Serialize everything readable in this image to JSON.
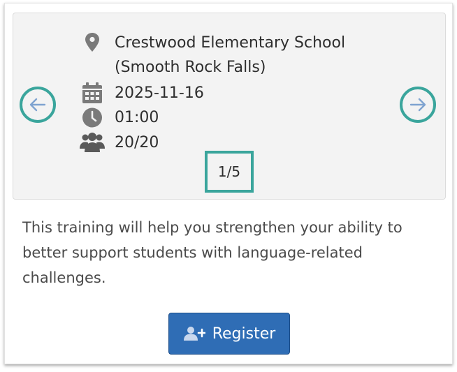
{
  "event": {
    "location_line1": "Crestwood Elementary School",
    "location_line2": "(Smooth Rock Falls)",
    "date": "2025-11-16",
    "time": "01:00",
    "seats": "20/20"
  },
  "slider": {
    "counter": "1/5",
    "prev_icon": "arrow-left-icon",
    "next_icon": "arrow-right-icon"
  },
  "description": "This training will help you strengthen your ability to better support students with language-related challenges.",
  "register": {
    "label": "Register",
    "icon": "user-plus-icon"
  },
  "colors": {
    "accent": "#3aa59c",
    "button": "#2f6db5",
    "arrow": "#7fa3d0",
    "icon": "#7a7a7a"
  }
}
